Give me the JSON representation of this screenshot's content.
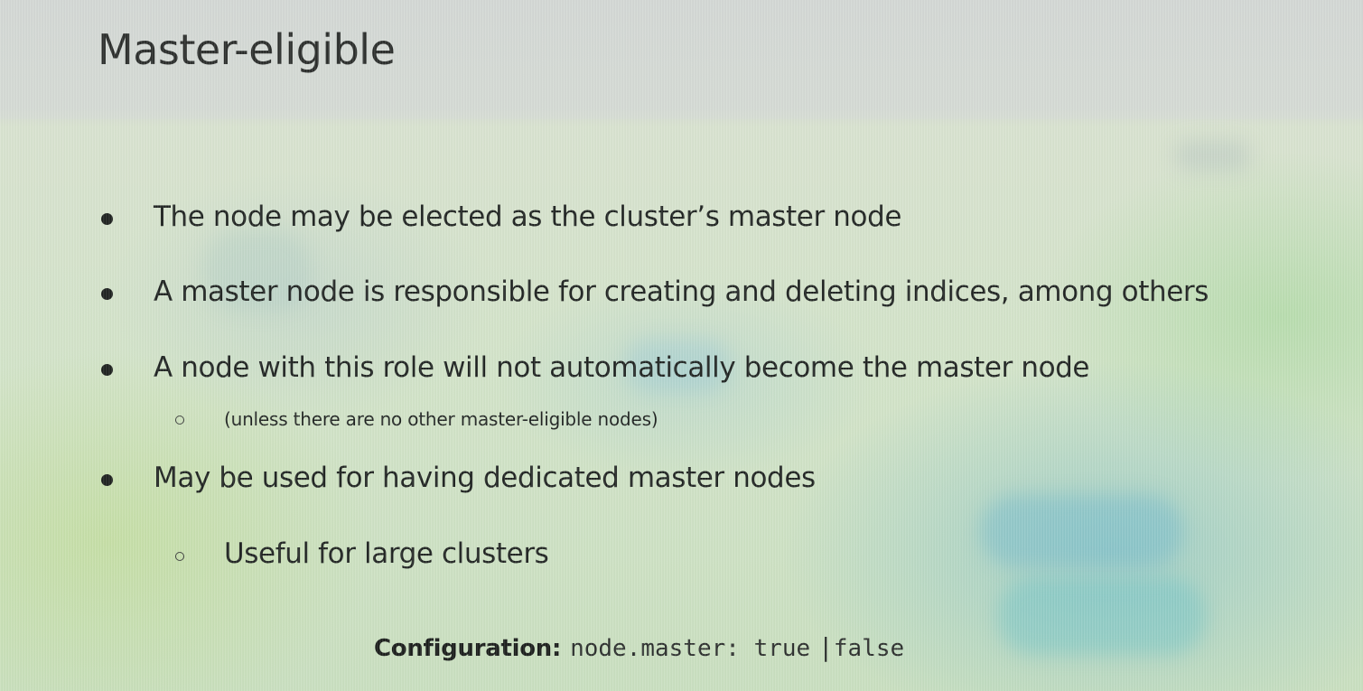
{
  "slide": {
    "title": "Master-eligible",
    "bullets": [
      {
        "text": "The node may be elected as the cluster’s master node"
      },
      {
        "text": "A master node is responsible for creating and deleting indices, among others"
      },
      {
        "text": "A node with this role will not automatically become the master node",
        "sub": "(unless there are no other master-eligible nodes)"
      },
      {
        "text": "May be used for having dedicated master nodes",
        "sub": "Useful for large clusters"
      }
    ],
    "configuration": {
      "label": "Configuration:",
      "code": "node.master: true",
      "pipe": "|",
      "alt": "false"
    }
  },
  "colors": {
    "text": "#1f2321",
    "background_top": "#d6dbd6",
    "background_bottom": "#c9dfbf",
    "accent_teal": "#78bec8",
    "accent_green": "#a0d796"
  }
}
